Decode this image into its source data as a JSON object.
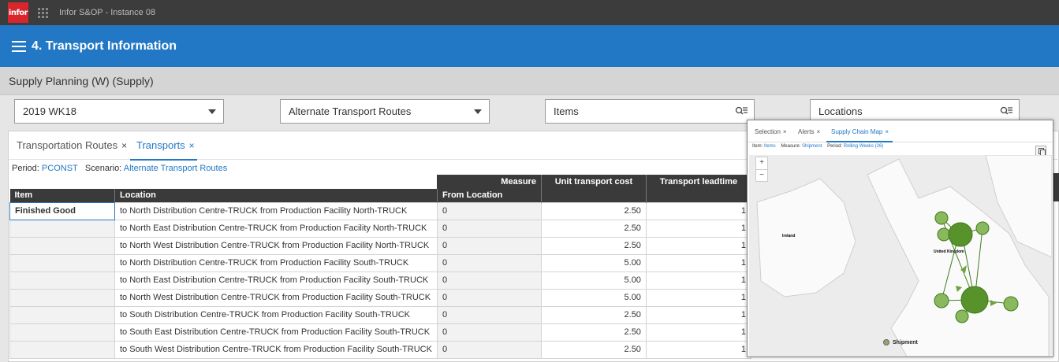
{
  "topbar": {
    "logo": "infor",
    "app_title": "Infor S&OP - Instance 08"
  },
  "header": {
    "title": "4. Transport Information"
  },
  "subheader": {
    "title": "Supply Planning (W) (Supply)"
  },
  "filters": {
    "period": "2019 WK18",
    "scenario": "Alternate Transport Routes",
    "items_placeholder": "Items",
    "locations_placeholder": "Locations"
  },
  "tabs": [
    {
      "label": "Transportation Routes",
      "close": "×"
    },
    {
      "label": "Transports",
      "close": "×"
    }
  ],
  "context": {
    "period_label": "Period:",
    "period_value": "PCONST",
    "scenario_label": "Scenario:",
    "scenario_value": "Alternate Transport Routes"
  },
  "table": {
    "measure_label": "Measure",
    "item_header": "Item",
    "location_header": "Location",
    "from_location_header": "From Location",
    "unit_cost_header": "Unit transport cost",
    "leadtime_header": "Transport leadtime",
    "rows": [
      {
        "item": "Finished Good",
        "location": "to North Distribution Centre-TRUCK from Production Facility North-TRUCK",
        "from": "0",
        "cost": "2.50",
        "lead": "1"
      },
      {
        "item": "",
        "location": "to North East Distribution Centre-TRUCK from Production Facility North-TRUCK",
        "from": "0",
        "cost": "2.50",
        "lead": "1"
      },
      {
        "item": "",
        "location": "to North West Distribution Centre-TRUCK from Production Facility North-TRUCK",
        "from": "0",
        "cost": "2.50",
        "lead": "1"
      },
      {
        "item": "",
        "location": "to North Distribution Centre-TRUCK from Production Facility South-TRUCK",
        "from": "0",
        "cost": "5.00",
        "lead": "1"
      },
      {
        "item": "",
        "location": "to North East Distribution Centre-TRUCK from Production Facility South-TRUCK",
        "from": "0",
        "cost": "5.00",
        "lead": "1"
      },
      {
        "item": "",
        "location": "to North West Distribution Centre-TRUCK from Production Facility South-TRUCK",
        "from": "0",
        "cost": "5.00",
        "lead": "1"
      },
      {
        "item": "",
        "location": "to South Distribution Centre-TRUCK from Production Facility South-TRUCK",
        "from": "0",
        "cost": "2.50",
        "lead": "1"
      },
      {
        "item": "",
        "location": "to South East Distribution Centre-TRUCK from Production Facility South-TRUCK",
        "from": "0",
        "cost": "2.50",
        "lead": "1"
      },
      {
        "item": "",
        "location": "to South West Distribution Centre-TRUCK from Production Facility South-TRUCK",
        "from": "0",
        "cost": "2.50",
        "lead": "1"
      }
    ]
  },
  "popup": {
    "tabs": [
      {
        "label": "Selection",
        "close": "×"
      },
      {
        "label": "Alerts",
        "close": "×"
      },
      {
        "label": "Supply Chain Map",
        "close": "×"
      }
    ],
    "context": {
      "item_label": "Item:",
      "item_value": "Items",
      "measure_label": "Measure:",
      "measure_value": "Shipment",
      "period_label": "Period:",
      "period_value": "Rolling Weeks (26)"
    },
    "zoom_in": "+",
    "zoom_out": "−",
    "map_labels": {
      "ireland": "Ireland",
      "uk": "United Kingdom"
    },
    "legend": "Shipment"
  },
  "colors": {
    "accent": "#2378c5",
    "node": "#6fa23e",
    "node_dark": "#3f7a1e"
  }
}
